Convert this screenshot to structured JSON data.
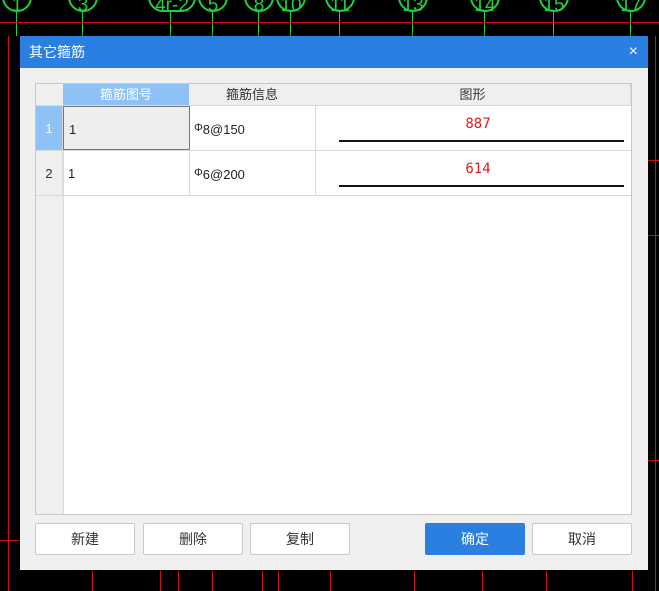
{
  "background": {
    "axis_labels": [
      "1",
      "3",
      "4r-2",
      "5",
      "8",
      "10",
      "11",
      "13",
      "14",
      "15",
      "17"
    ]
  },
  "dialog": {
    "title": "其它箍筋",
    "close_symbol": "×",
    "columns": [
      "箍筋图号",
      "箍筋信息",
      "图形"
    ],
    "rows": [
      {
        "num": "1",
        "figure_no": "1",
        "rebar_symbol": "Φ",
        "rebar_spec": "8@150",
        "shape_value": "887"
      },
      {
        "num": "2",
        "figure_no": "1",
        "rebar_symbol": "Φ",
        "rebar_spec": "6@200",
        "shape_value": "614"
      }
    ],
    "buttons": {
      "new": "新建",
      "delete": "删除",
      "copy": "复制",
      "ok": "确定",
      "cancel": "取消"
    }
  },
  "colors": {
    "accent": "#2b7fe0",
    "selected_header": "#8ec2f6",
    "shape_value": "#e01b1b",
    "cad_red": "#d01010",
    "cad_green": "#1fd13a"
  }
}
